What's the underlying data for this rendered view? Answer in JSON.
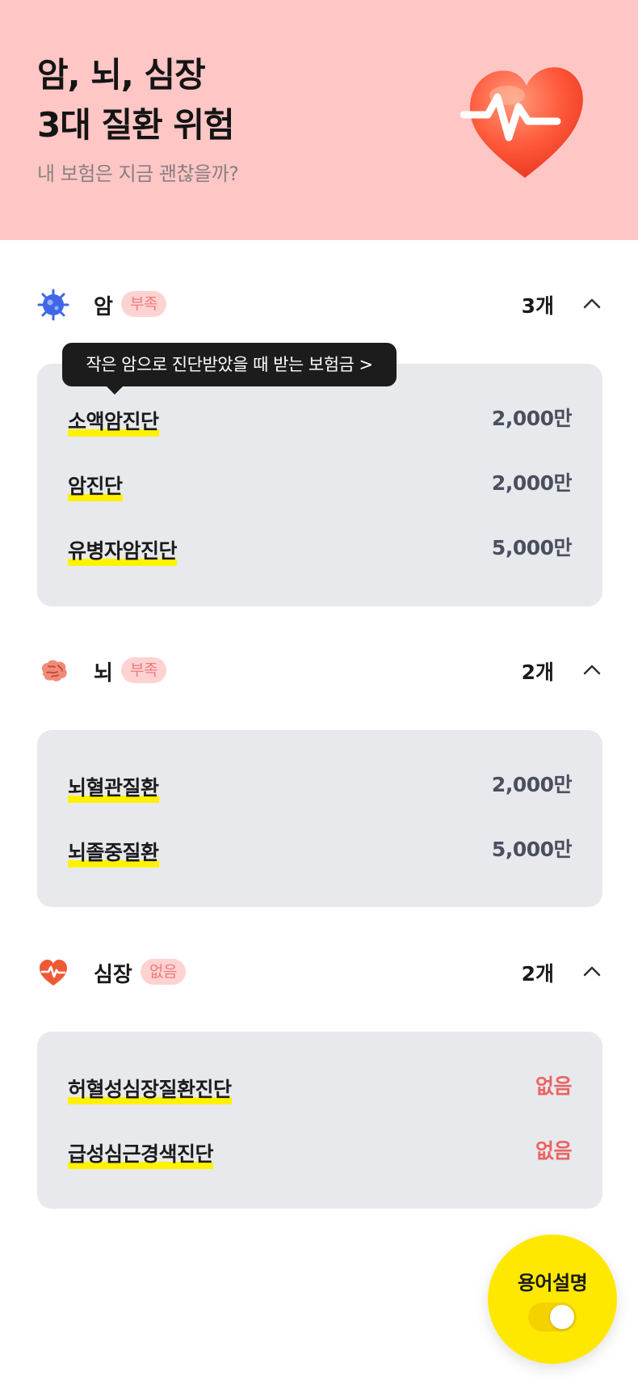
{
  "hero": {
    "title_line1": "암, 뇌, 심장",
    "title_line2": "3대 질환 위험",
    "subtitle": "내 보험은 지금 괜찮을까?",
    "image": "heart-pulse-icon",
    "background": "#ffc6c6"
  },
  "tooltip": {
    "text": "작은 암으로 진단받았을 때 받는 보험금 >"
  },
  "sections": [
    {
      "name": "암",
      "icon": "cancer-cell-icon",
      "badge": "부족",
      "count": "3개",
      "expanded": true,
      "items": [
        {
          "label": "소액암진단",
          "value": "2,000만"
        },
        {
          "label": "암진단",
          "value": "2,000만"
        },
        {
          "label": "유병자암진단",
          "value": "5,000만"
        }
      ]
    },
    {
      "name": "뇌",
      "icon": "brain-icon",
      "badge": "부족",
      "count": "2개",
      "expanded": true,
      "items": [
        {
          "label": "뇌혈관질환",
          "value": "2,000만"
        },
        {
          "label": "뇌졸중질환",
          "value": "5,000만"
        }
      ]
    },
    {
      "name": "심장",
      "icon": "heart-pulse-icon",
      "badge": "없음",
      "count": "2개",
      "expanded": true,
      "items": [
        {
          "label": "허혈성심장질환진단",
          "value": "없음"
        },
        {
          "label": "급성심근경색진단",
          "value": "없음"
        }
      ]
    }
  ],
  "glossary": {
    "label": "용어설명",
    "toggle_on": true
  },
  "colors": {
    "highlight": "#fff200",
    "badge_bg": "#ffd2d2",
    "badge_text": "#f07a7a",
    "none_value": "#ea6464",
    "card_bg": "#e8e9ec",
    "fab": "#ffe800"
  }
}
